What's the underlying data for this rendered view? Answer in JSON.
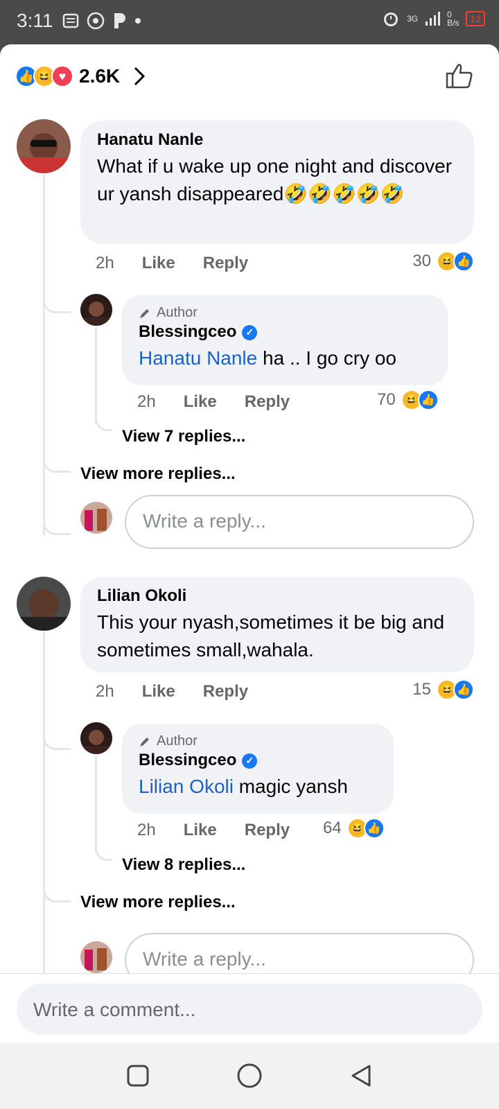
{
  "status": {
    "time": "3:11",
    "network": "3G",
    "speed": "0\nB/s",
    "battery": "12"
  },
  "reactions": {
    "count": "2.6K"
  },
  "comments": [
    {
      "author": "Hanatu Nanle",
      "text": "What if u wake up one night and discover ur yansh disappeared🤣🤣🤣🤣🤣",
      "time": "2h",
      "like": "Like",
      "reply": "Reply",
      "reactions": "30",
      "author_reply": {
        "tag": "Author",
        "author": "Blessingceo",
        "mention": "Hanatu Nanle",
        "text": " ha ..  I go cry oo",
        "time": "2h",
        "like": "Like",
        "reply": "Reply",
        "reactions": "70"
      },
      "view_replies": "View 7 replies...",
      "view_more": "View more replies...",
      "reply_placeholder": "Write a reply..."
    },
    {
      "author": "Lilian Okoli",
      "text": "This your nyash,sometimes it be big and sometimes small,wahala.",
      "time": "2h",
      "like": "Like",
      "reply": "Reply",
      "reactions": "15",
      "author_reply": {
        "tag": "Author",
        "author": "Blessingceo",
        "mention": "Lilian Okoli",
        "text": " magic yansh",
        "time": "2h",
        "like": "Like",
        "reply": "Reply",
        "reactions": "64"
      },
      "view_replies": "View 8 replies...",
      "view_more": "View more replies...",
      "reply_placeholder": "Write a reply..."
    }
  ],
  "comment_placeholder": "Write a comment...",
  "colors": {
    "like_blue": "#1877f2",
    "link_blue": "#1b62c8",
    "bubble": "#f0f2f5"
  }
}
